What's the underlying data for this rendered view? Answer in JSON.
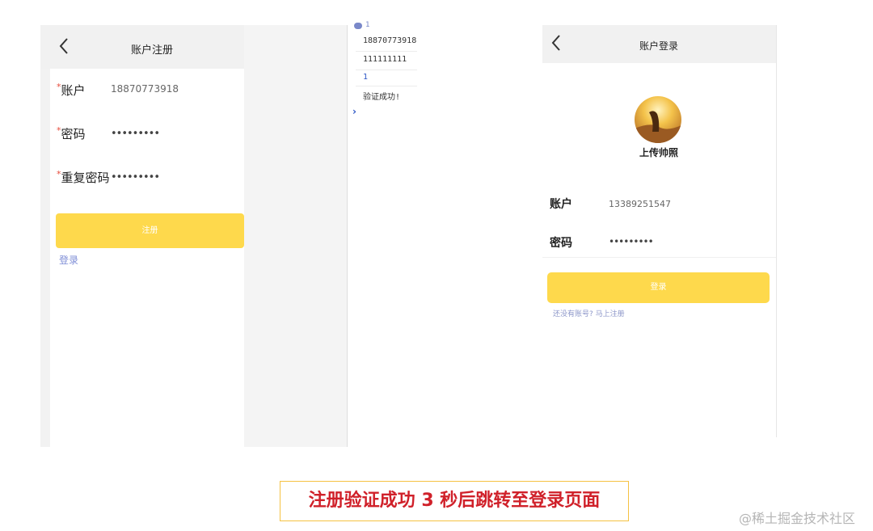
{
  "register": {
    "back_icon": "chevron-left-icon",
    "title": "账户注册",
    "required_mark": "*",
    "account_label": "账户",
    "account_value": "18870773918",
    "password_label": "密码",
    "password_value": "•••••••••",
    "repeat_label": "重复密码",
    "repeat_value": "•••••••••",
    "submit_label": "注册",
    "login_link": "登录"
  },
  "console": {
    "badge": "1",
    "lines": [
      "18870773918",
      "111111111",
      "1",
      "验证成功!"
    ],
    "prompt": "›"
  },
  "login": {
    "back_icon": "chevron-left-icon",
    "title": "账户登录",
    "upload_label": "上传帅照",
    "account_label": "账户",
    "account_value": "13389251547",
    "password_label": "密码",
    "password_value": "•••••••••",
    "submit_label": "登录",
    "register_link": "还没有账号? 马上注册"
  },
  "caption": "注册验证成功 3 秒后跳转至登录页面",
  "watermark": "@稀土掘金技术社区",
  "colors": {
    "accent_yellow": "#fed94c",
    "link_blue": "#7e8dd6",
    "caption_red": "#d0212a",
    "caption_border": "#f5c242"
  }
}
